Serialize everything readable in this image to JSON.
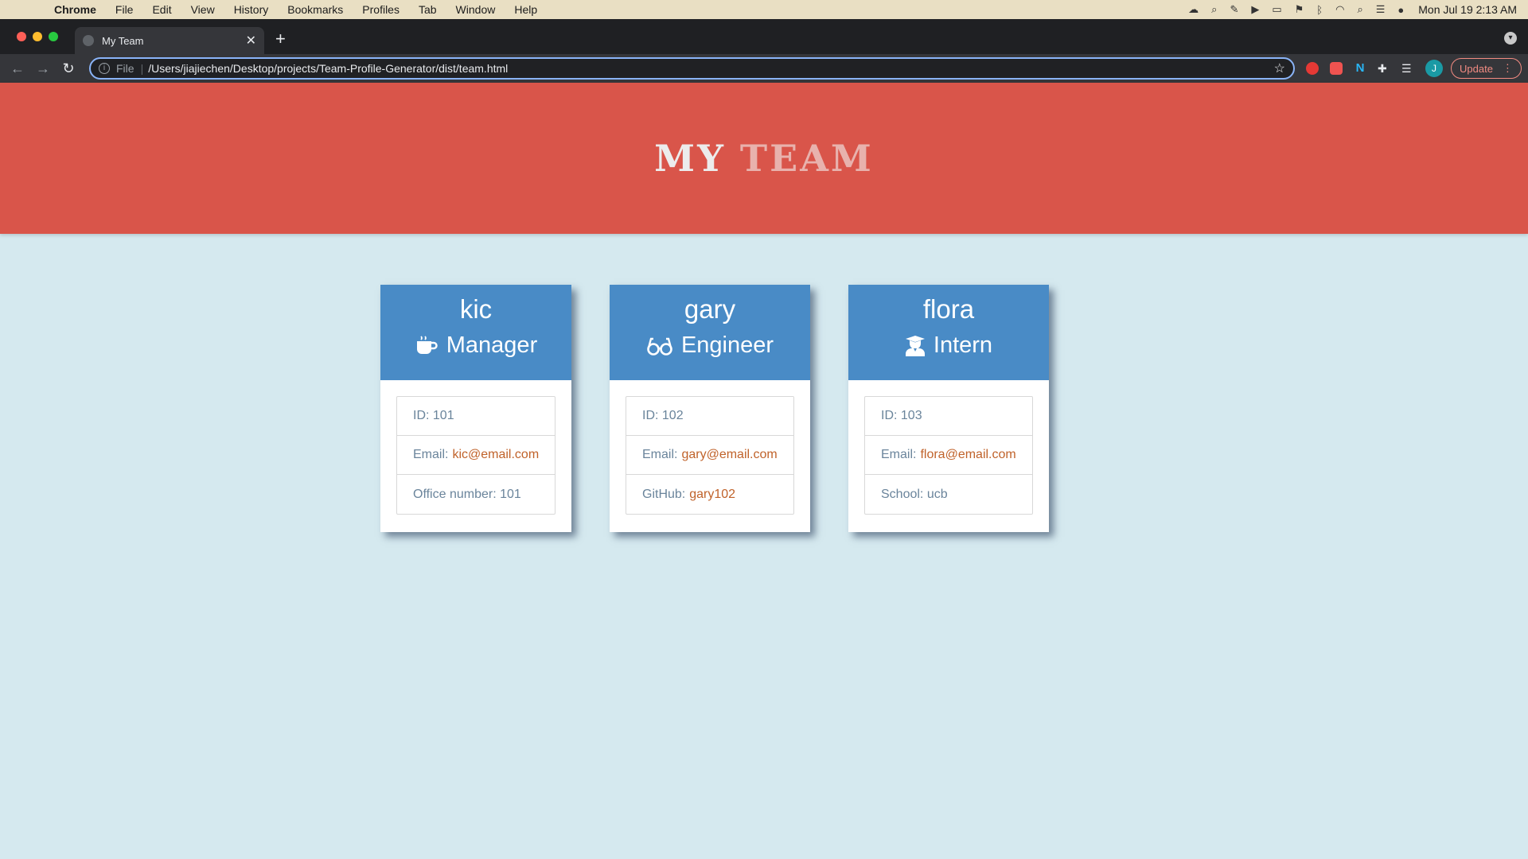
{
  "menubar": {
    "app": "Chrome",
    "items": [
      "File",
      "Edit",
      "View",
      "History",
      "Bookmarks",
      "Profiles",
      "Tab",
      "Window",
      "Help"
    ],
    "clock": "Mon Jul 19  2:13 AM"
  },
  "browser": {
    "tab_title": "My Team",
    "address_scheme": "File",
    "address_url": "/Users/jiajiechen/Desktop/projects/Team-Profile-Generator/dist/team.html",
    "profile_initial": "J",
    "update_label": "Update"
  },
  "page": {
    "title_word1": "MY",
    "title_word2": "TEAM"
  },
  "team": [
    {
      "name": "kic",
      "role": "Manager",
      "icon": "coffee-icon",
      "id_label": "ID: 101",
      "email_label": "Email:",
      "email": "kic@email.com",
      "extra_label": "Office number: 101",
      "extra_link": ""
    },
    {
      "name": "gary",
      "role": "Engineer",
      "icon": "glasses-icon",
      "id_label": "ID: 102",
      "email_label": "Email:",
      "email": "gary@email.com",
      "extra_label": "GitHub:",
      "extra_link": "gary102"
    },
    {
      "name": "flora",
      "role": "Intern",
      "icon": "graduate-icon",
      "id_label": "ID: 103",
      "email_label": "Email:",
      "email": "flora@email.com",
      "extra_label": "School: ucb",
      "extra_link": ""
    }
  ],
  "colors": {
    "header": "#d9554a",
    "card_head": "#498bc6",
    "background": "#d5e9ef",
    "link": "#c0622a"
  }
}
